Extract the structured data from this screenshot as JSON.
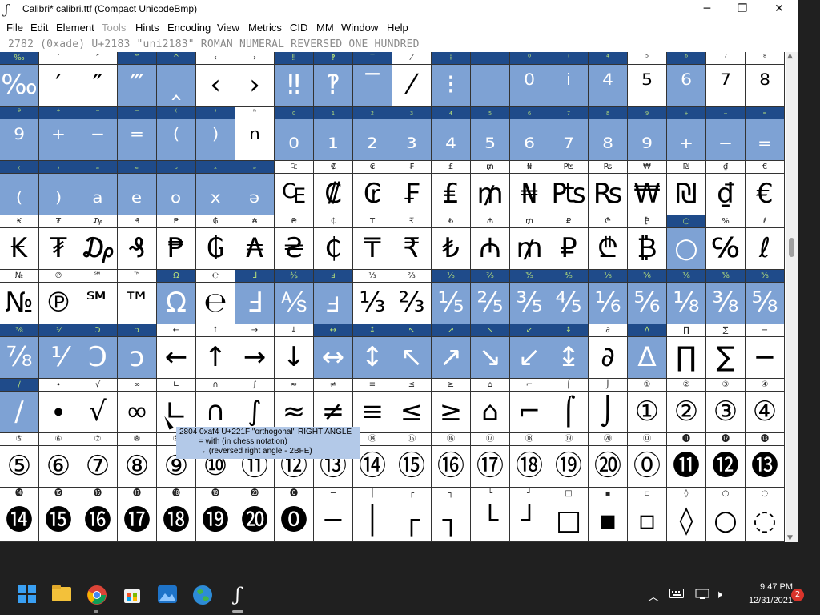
{
  "window": {
    "title": "Calibri*  calibri.ttf (Compact UnicodeBmp)",
    "minimize": "─",
    "maximize": "❐",
    "close": "✕"
  },
  "menu": [
    "File",
    "Edit",
    "Element",
    "Tools",
    "Hints",
    "Encoding",
    "View",
    "Metrics",
    "CID",
    "MM",
    "Window",
    "Help"
  ],
  "disabled_menu": [
    "Tools"
  ],
  "info_line": "2782 (0xade) U+2183 \"uni2183\" ROMAN NUMERAL REVERSED ONE HUNDRED",
  "colors": {
    "selected_label_bg": "#1f4b8a",
    "selected_label_fg": "#b6e07a",
    "selected_glyph_bg": "#7ea2d4",
    "tooltip_bg": "#b3c9e8"
  },
  "glyph_rows": [
    {
      "labels": [
        "‰",
        "′",
        "″",
        "‴",
        "^",
        "‹",
        "›",
        "‼",
        "‽",
        "‾",
        "⁄",
        "⁝",
        "",
        "⁰",
        "ⁱ",
        "⁴",
        "⁵",
        "⁶",
        "⁷",
        "⁸"
      ],
      "glyphs": [
        "‰",
        "′",
        "″",
        "‴",
        "‸",
        "‹",
        "›",
        "‼",
        "‽",
        "‾",
        "⁄",
        "⁝",
        "",
        "⁰",
        "ⁱ",
        "⁴",
        "⁵",
        "⁶",
        "⁷",
        "⁸"
      ],
      "selected": [
        0,
        3,
        4,
        7,
        8,
        9,
        11,
        12,
        13,
        14,
        15,
        17
      ]
    },
    {
      "labels": [
        "⁹",
        "⁺",
        "⁻",
        "⁼",
        "⁽",
        "⁾",
        "ⁿ",
        "₀",
        "₁",
        "₂",
        "₃",
        "₄",
        "₅",
        "₆",
        "₇",
        "₈",
        "₉",
        "₊",
        "₋",
        "₌"
      ],
      "glyphs": [
        "⁹",
        "⁺",
        "⁻",
        "⁼",
        "⁽",
        "⁾",
        "ⁿ",
        "₀",
        "₁",
        "₂",
        "₃",
        "₄",
        "₅",
        "₆",
        "₇",
        "₈",
        "₉",
        "₊",
        "₋",
        "₌"
      ],
      "selected": [
        0,
        1,
        2,
        3,
        4,
        5,
        7,
        8,
        9,
        10,
        11,
        12,
        13,
        14,
        15,
        16,
        17,
        18,
        19
      ]
    },
    {
      "labels": [
        "₍",
        "₎",
        "ₐ",
        "ₑ",
        "ₒ",
        "ₓ",
        "ₔ",
        "₠",
        "₡",
        "₢",
        "₣",
        "₤",
        "₥",
        "₦",
        "₧",
        "₨",
        "₩",
        "₪",
        "₫",
        "€"
      ],
      "glyphs": [
        "₍",
        "₎",
        "ₐ",
        "ₑ",
        "ₒ",
        "ₓ",
        "ₔ",
        "₠",
        "₡",
        "₢",
        "₣",
        "₤",
        "₥",
        "₦",
        "₧",
        "₨",
        "₩",
        "₪",
        "₫",
        "€"
      ],
      "selected": [
        0,
        1,
        2,
        3,
        4,
        5,
        6
      ]
    },
    {
      "labels": [
        "₭",
        "₮",
        "₯",
        "₰",
        "₱",
        "₲",
        "₳",
        "₴",
        "₵",
        "₸",
        "₹",
        "₺",
        "₼",
        "₥",
        "₽",
        "₾",
        "₿",
        "○",
        "%",
        "ℓ"
      ],
      "glyphs": [
        "₭",
        "₮",
        "₯",
        "₰",
        "₱",
        "₲",
        "₳",
        "₴",
        "₵",
        "₸",
        "₹",
        "₺",
        "₼",
        "₥",
        "₽",
        "₾",
        "₿",
        "○",
        "℅",
        "ℓ"
      ],
      "selected": [
        17
      ]
    },
    {
      "labels": [
        "№",
        "℗",
        "℠",
        "™",
        "Ω",
        "℮",
        "Ⅎ",
        "⅍",
        "ⅎ",
        "⅓",
        "⅔",
        "⅕",
        "⅖",
        "⅗",
        "⅘",
        "⅙",
        "⅚",
        "⅛",
        "⅜",
        "⅝"
      ],
      "glyphs": [
        "№",
        "℗",
        "℠",
        "™",
        "Ω",
        "℮",
        "Ⅎ",
        "⅍",
        "ⅎ",
        "⅓",
        "⅔",
        "⅕",
        "⅖",
        "⅗",
        "⅘",
        "⅙",
        "⅚",
        "⅛",
        "⅜",
        "⅝"
      ],
      "selected": [
        4,
        6,
        7,
        8,
        11,
        12,
        13,
        14,
        15,
        16,
        17,
        18,
        19
      ]
    },
    {
      "labels": [
        "⅞",
        "⅟",
        "Ↄ",
        "ↄ",
        "←",
        "↑",
        "→",
        "↓",
        "↔",
        "↕",
        "↖",
        "↗",
        "↘",
        "↙",
        "↨",
        "∂",
        "∆",
        "∏",
        "∑",
        "−"
      ],
      "glyphs": [
        "⅞",
        "⅟",
        "Ↄ",
        "ↄ",
        "←",
        "↑",
        "→",
        "↓",
        "↔",
        "↕",
        "↖",
        "↗",
        "↘",
        "↙",
        "↨",
        "∂",
        "∆",
        "∏",
        "∑",
        "−"
      ],
      "selected": [
        0,
        1,
        2,
        3,
        8,
        9,
        10,
        11,
        12,
        13,
        14,
        16
      ]
    },
    {
      "labels": [
        "∕",
        "∙",
        "√",
        "∞",
        "∟",
        "∩",
        "∫",
        "≈",
        "≠",
        "≡",
        "≤",
        "≥",
        "⌂",
        "⌐",
        "⌠",
        "⌡",
        "①",
        "②",
        "③",
        "④"
      ],
      "glyphs": [
        "∕",
        "∙",
        "√",
        "∞",
        "∟",
        "∩",
        "∫",
        "≈",
        "≠",
        "≡",
        "≤",
        "≥",
        "⌂",
        "⌐",
        "⌠",
        "⌡",
        "①",
        "②",
        "③",
        "④"
      ],
      "selected": [
        0
      ]
    },
    {
      "labels": [
        "⑤",
        "⑥",
        "⑦",
        "⑧",
        "⑨",
        "⑩",
        "⑪",
        "⑫",
        "⑬",
        "⑭",
        "⑮",
        "⑯",
        "⑰",
        "⑱",
        "⑲",
        "⑳",
        "⓪",
        "⓫",
        "⓬",
        "⓭"
      ],
      "glyphs": [
        "⑤",
        "⑥",
        "⑦",
        "⑧",
        "⑨",
        "⑩",
        "⑪",
        "⑫",
        "⑬",
        "⑭",
        "⑮",
        "⑯",
        "⑰",
        "⑱",
        "⑲",
        "⑳",
        "⓪",
        "⓫",
        "⓬",
        "⓭"
      ],
      "selected": []
    },
    {
      "labels": [
        "⓮",
        "⓯",
        "⓰",
        "⓱",
        "⓲",
        "⓳",
        "⓴",
        "⓿",
        "─",
        "│",
        "┌",
        "┐",
        "└",
        "┘",
        "□",
        "▪",
        "▫",
        "◊",
        "○",
        "◌"
      ],
      "glyphs": [
        "⓮",
        "⓯",
        "⓰",
        "⓱",
        "⓲",
        "⓳",
        "⓴",
        "⓿",
        "─",
        "│",
        "┌",
        "┐",
        "└",
        "┘",
        "□",
        "▪",
        "▫",
        "◊",
        "○",
        "◌"
      ],
      "selected": []
    }
  ],
  "tooltip": {
    "line1": "2804 0xaf4 U+221F \"orthogonal\" RIGHT ANGLE",
    "line2": "= with (in chess notation)",
    "line3": "→ (reversed right angle - 2BFE)"
  },
  "taskbar": {
    "icons": [
      "windows-start-icon",
      "file-explorer-icon",
      "chrome-icon",
      "store-icon",
      "photos-icon",
      "globe-icon",
      "fontforge-icon"
    ],
    "tray_chevron": "︿",
    "time": "9:47 PM",
    "date": "12/31/2021",
    "notification_count": "2"
  }
}
